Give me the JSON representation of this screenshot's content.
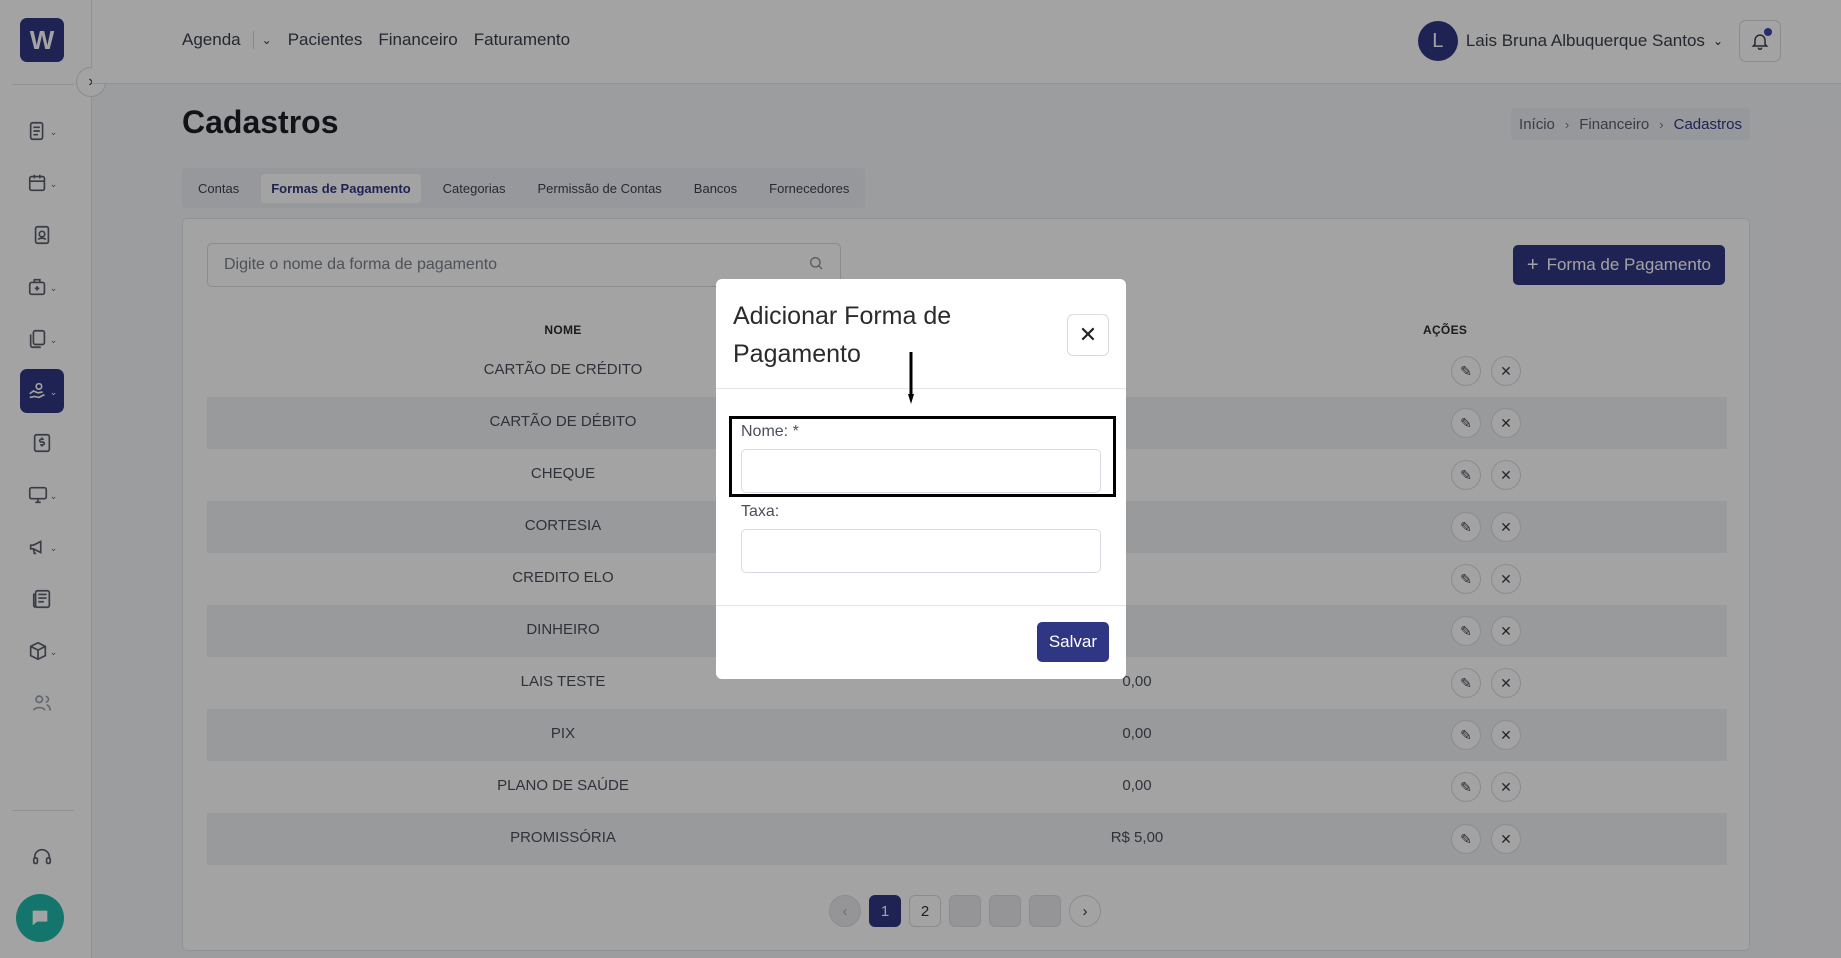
{
  "sidebar": {
    "logo": "W",
    "items": [
      {
        "icon": "report-icon",
        "chevron": true
      },
      {
        "icon": "calendar-icon",
        "chevron": true
      },
      {
        "icon": "patient-card-icon",
        "chevron": false
      },
      {
        "icon": "hospital-icon",
        "chevron": true
      },
      {
        "icon": "documents-icon",
        "chevron": true
      },
      {
        "icon": "hand-money-icon",
        "chevron": true,
        "active": true
      },
      {
        "icon": "dollar-doc-icon",
        "chevron": false
      },
      {
        "icon": "monitor-icon",
        "chevron": true
      },
      {
        "icon": "megaphone-icon",
        "chevron": true
      },
      {
        "icon": "news-icon",
        "chevron": false
      },
      {
        "icon": "package-icon",
        "chevron": true
      },
      {
        "icon": "users-icon",
        "chevron": false
      }
    ],
    "support_icon": "headset-icon",
    "chat_icon": "chat-icon"
  },
  "topnav": {
    "items": [
      "Agenda",
      "Pacientes",
      "Financeiro",
      "Faturamento"
    ],
    "user_initial": "L",
    "user_name": "Lais Bruna Albuquerque Santos"
  },
  "page": {
    "title": "Cadastros",
    "breadcrumb": [
      "Início",
      "Financeiro",
      "Cadastros"
    ]
  },
  "tabs": [
    {
      "label": "Contas"
    },
    {
      "label": "Formas de Pagamento",
      "active": true
    },
    {
      "label": "Categorias"
    },
    {
      "label": "Permissão de Contas"
    },
    {
      "label": "Bancos"
    },
    {
      "label": "Fornecedores"
    }
  ],
  "search": {
    "placeholder": "Digite o nome da forma de pagamento"
  },
  "add_button": "Forma de Pagamento",
  "table": {
    "headers": {
      "name": "NOME",
      "actions": "AÇÕES"
    },
    "rows": [
      {
        "name": "CARTÃO DE CRÉDITO",
        "rate": ""
      },
      {
        "name": "CARTÃO DE DÉBITO",
        "rate": ""
      },
      {
        "name": "CHEQUE",
        "rate": ""
      },
      {
        "name": "CORTESIA",
        "rate": ""
      },
      {
        "name": "CREDITO ELO",
        "rate": ""
      },
      {
        "name": "DINHEIRO",
        "rate": ""
      },
      {
        "name": "LAIS TESTE",
        "rate": "0,00"
      },
      {
        "name": "PIX",
        "rate": "0,00"
      },
      {
        "name": "PLANO DE SAÚDE",
        "rate": "0,00"
      },
      {
        "name": "PROMISSÓRIA",
        "rate": "R$ 5,00"
      }
    ]
  },
  "pagination": {
    "pages": [
      "1",
      "2"
    ],
    "current": "1"
  },
  "modal": {
    "title": "Adicionar Forma de Pagamento",
    "name_label": "Nome: *",
    "name_value": "",
    "rate_label": "Taxa:",
    "rate_value": "",
    "save_label": "Salvar"
  },
  "colors": {
    "primary": "#2f3784",
    "chat": "#1fb8a8"
  }
}
